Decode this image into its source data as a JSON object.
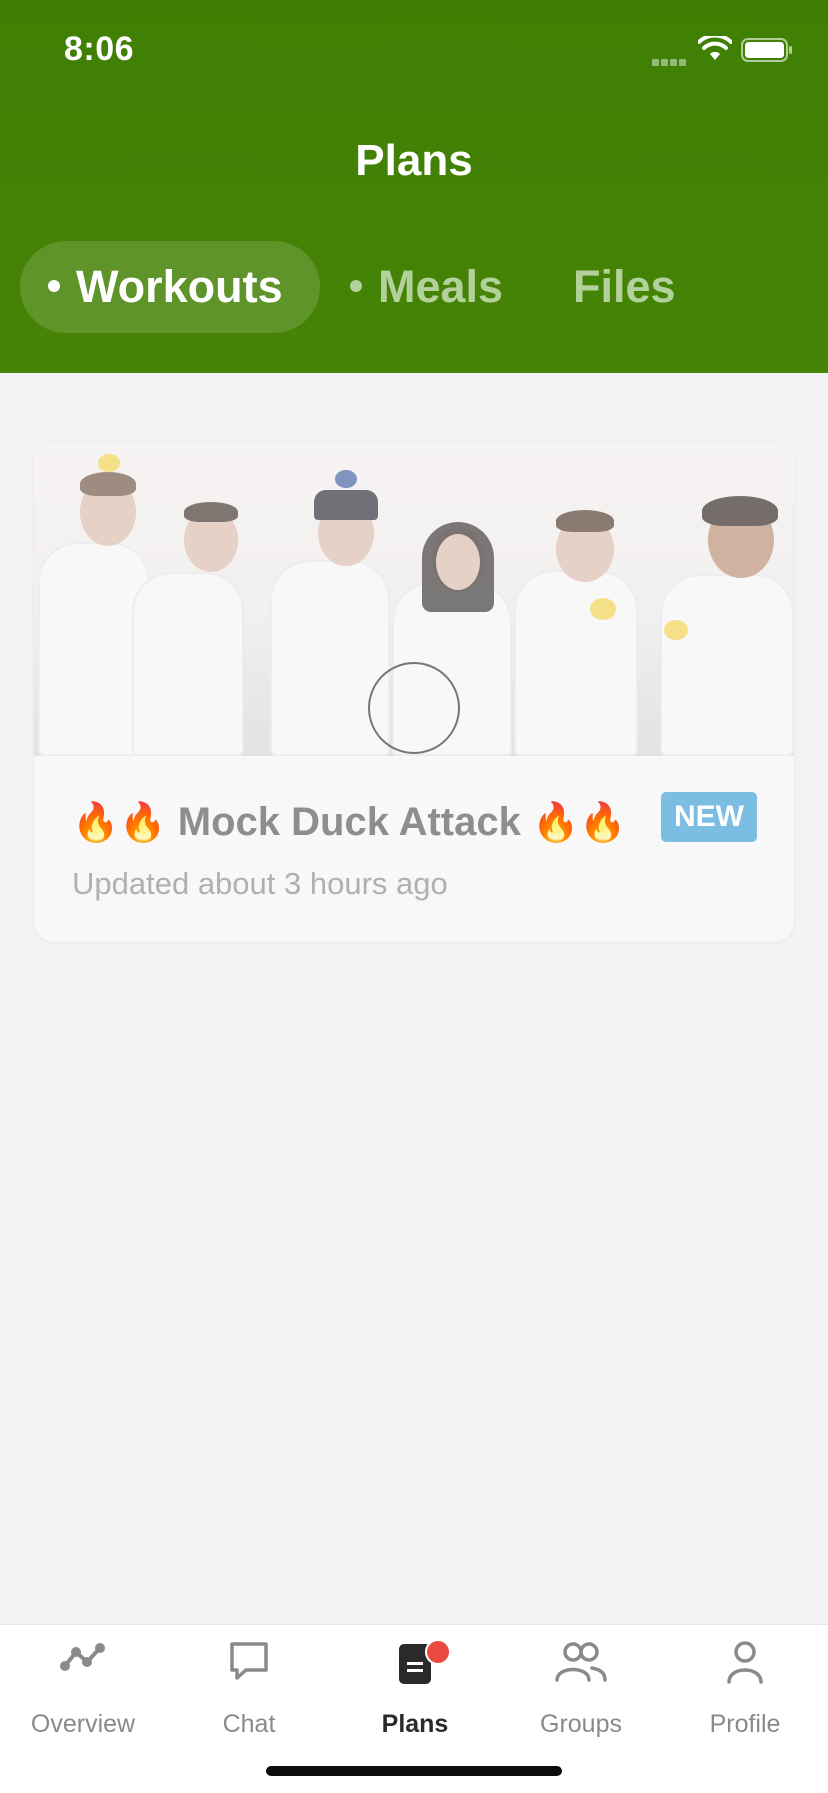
{
  "status_bar": {
    "time": "8:06"
  },
  "header": {
    "title": "Plans"
  },
  "tabs": [
    {
      "label": "Workouts",
      "active": true
    },
    {
      "label": "Meals",
      "active": false
    },
    {
      "label": "Files",
      "active": false
    }
  ],
  "plan_card": {
    "title_prefix": "🔥🔥",
    "title": "Mock Duck Attack",
    "title_suffix": "🔥🔥",
    "badge": "NEW",
    "subtitle": "Updated about 3 hours ago"
  },
  "tab_bar": {
    "items": [
      {
        "label": "Overview",
        "icon": "overview-icon"
      },
      {
        "label": "Chat",
        "icon": "chat-icon"
      },
      {
        "label": "Plans",
        "icon": "plans-icon",
        "active": true
      },
      {
        "label": "Groups",
        "icon": "groups-icon"
      },
      {
        "label": "Profile",
        "icon": "profile-icon"
      }
    ]
  },
  "colors": {
    "header_green": "#3f7f03",
    "inactive_tab_text": "#b3d19a",
    "badge_blue": "#7bbde3",
    "notification_red": "#ea4a3f"
  }
}
